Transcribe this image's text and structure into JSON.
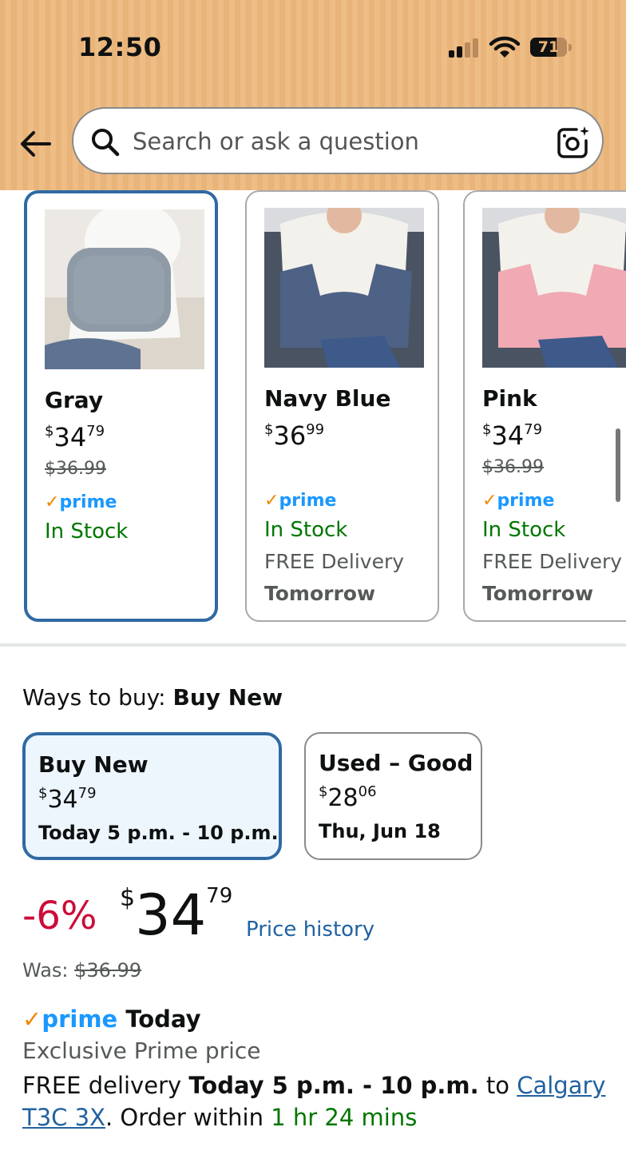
{
  "status_bar": {
    "time": "12:50",
    "battery": "71"
  },
  "search": {
    "placeholder": "Search or ask a question"
  },
  "variants": [
    {
      "name": "Gray",
      "price_currency": "$",
      "price_whole": "34",
      "price_fraction": "79",
      "old_price": "$36.99",
      "prime": "prime",
      "stock": "In Stock",
      "delivery": "",
      "delivery_day": "",
      "selected": true,
      "color": "#8e9aa6"
    },
    {
      "name": "Navy Blue",
      "price_currency": "$",
      "price_whole": "36",
      "price_fraction": "99",
      "old_price": "",
      "prime": "prime",
      "stock": "In Stock",
      "delivery": "FREE Delivery",
      "delivery_day": "Tomorrow",
      "selected": false,
      "color": "#4d6284"
    },
    {
      "name": "Pink",
      "price_currency": "$",
      "price_whole": "34",
      "price_fraction": "79",
      "old_price": "$36.99",
      "prime": "prime",
      "stock": "In Stock",
      "delivery": "FREE Delivery",
      "delivery_day": "Tomorrow",
      "selected": false,
      "color": "#f1a9b3"
    }
  ],
  "ways_to_buy": {
    "label": "Ways to buy:",
    "selected": "Buy New",
    "options": [
      {
        "title": "Buy New",
        "price_currency": "$",
        "price_whole": "34",
        "price_fraction": "79",
        "delivery": "Today 5 p.m. - 10 p.m.",
        "selected": true
      },
      {
        "title": "Used – Good",
        "price_currency": "$",
        "price_whole": "28",
        "price_fraction": "06",
        "delivery": "Thu, Jun 18",
        "selected": false
      }
    ]
  },
  "pricing": {
    "discount": "-6%",
    "currency": "$",
    "whole": "34",
    "fraction": "79",
    "price_history": "Price history",
    "was_label": "Was:",
    "was_price": "$36.99"
  },
  "prime_section": {
    "prime_label": "prime",
    "today_label": "Today",
    "exclusive": "Exclusive Prime price",
    "free_delivery": "FREE delivery",
    "window": "Today 5 p.m. - 10 p.m.",
    "to": "to",
    "location": "Calgary T3C 3X",
    "order_within_prefix": ". Order within",
    "countdown": "1 hr 24 mins"
  },
  "colors": {
    "header_bg": "#eab77d",
    "selected_border": "#2f6aa3",
    "link": "#2162a1",
    "in_stock": "#007600",
    "discount": "#cc0c39",
    "prime_blue": "#1a98ff",
    "prime_check": "#f08804"
  }
}
